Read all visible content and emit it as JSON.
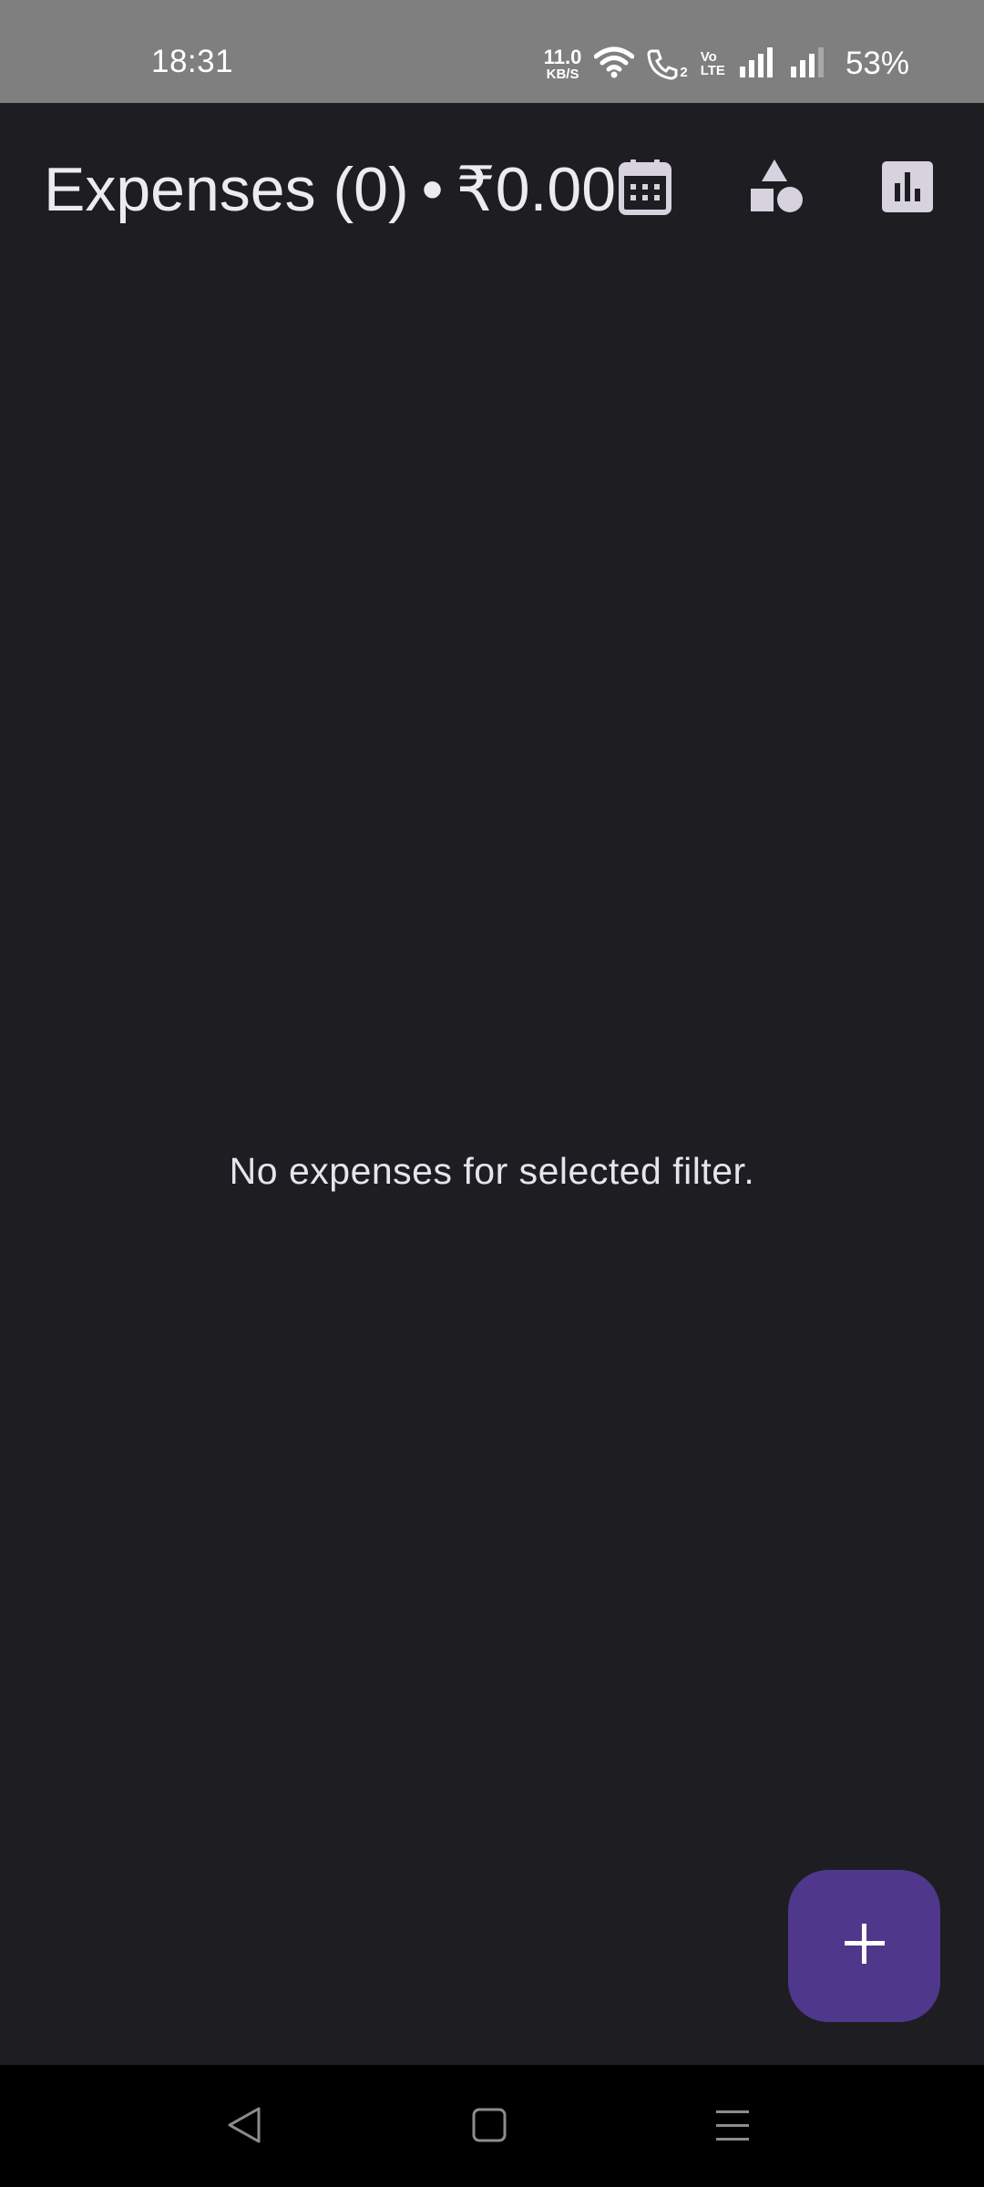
{
  "status_bar": {
    "time": "18:31",
    "net_speed_value": "11.0",
    "net_speed_unit": "KB/S",
    "volte_top": "Vo",
    "volte_bottom": "LTE",
    "sim_badge": "2",
    "battery": "53%"
  },
  "app_bar": {
    "title": "Expenses (0)",
    "separator": "•",
    "total": "₹0.00",
    "actions": [
      {
        "icon": "calendar-icon"
      },
      {
        "icon": "category-shapes-icon"
      },
      {
        "icon": "bar-chart-icon"
      }
    ]
  },
  "main": {
    "empty_message": "No expenses for selected filter."
  },
  "fab": {
    "icon": "plus-icon"
  },
  "nav_bar": {
    "buttons": [
      "back-icon",
      "home-icon",
      "recents-icon"
    ]
  },
  "colors": {
    "background": "#1e1d22",
    "status_bar": "#7f7f7f",
    "fab": "#4f378b",
    "icon": "#d6d2de",
    "text": "#e6e4ec"
  }
}
